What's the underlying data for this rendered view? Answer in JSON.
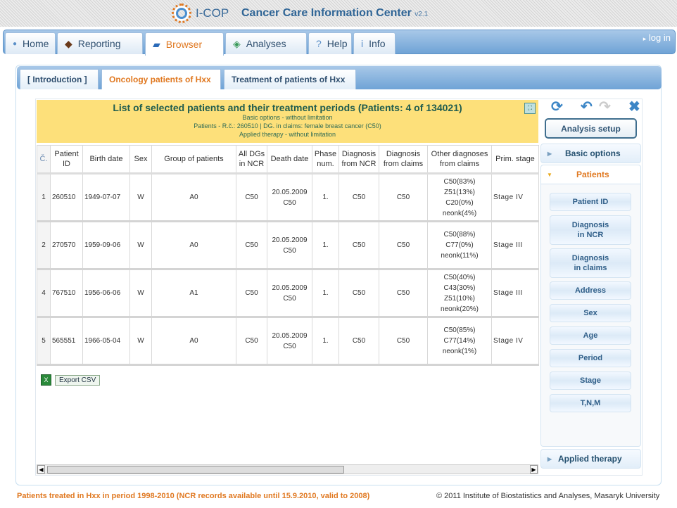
{
  "header": {
    "logo": "I-COP",
    "title": "Cancer Care Information Center",
    "version": "v2.1"
  },
  "nav": {
    "tabs": [
      {
        "label": "Home",
        "icon": "bullet-icon"
      },
      {
        "label": "Reporting",
        "icon": "book-icon"
      },
      {
        "label": "Browser",
        "icon": "monitor-icon",
        "active": true
      },
      {
        "label": "Analyses",
        "icon": "chart-icon"
      },
      {
        "label": "Help",
        "icon": "question-icon"
      },
      {
        "label": "Info",
        "icon": "info-icon"
      }
    ],
    "login": "log in"
  },
  "subtabs": [
    {
      "label": "[ Introduction ]"
    },
    {
      "label": "Oncology patients of Hxx",
      "active": true
    },
    {
      "label": "Treatment of patients of Hxx"
    }
  ],
  "list": {
    "title": "List of selected patients and their treatment periods (Patients: 4 of 134021)",
    "lines": [
      "Basic options - without limitation",
      "Patients - R.č.: 260510 | DG. in claims: female breast cancer (C50)",
      "Applied therapy - without limitation"
    ]
  },
  "table": {
    "columns": [
      "Č.",
      "Patient ID",
      "Birth date",
      "Sex",
      "Group of patients",
      "All DGs in NCR",
      "Death date",
      "Phase num.",
      "Diagnosis from NCR",
      "Diagnosis from claims",
      "Other diagnoses from claims",
      "Prim. stage"
    ],
    "rows": [
      [
        "1",
        "260510",
        "1949-07-07",
        "W",
        "A0",
        "C50",
        [
          "20.05.2009",
          "C50"
        ],
        "1.",
        "C50",
        "C50",
        [
          "C50(83%)",
          "Z51(13%)",
          "C20(0%)",
          "neonk(4%)"
        ],
        "Stage IV"
      ],
      [
        "2",
        "270570",
        "1959-09-06",
        "W",
        "A0",
        "C50",
        [
          "20.05.2009",
          "C50"
        ],
        "1.",
        "C50",
        "C50",
        [
          "C50(88%)",
          "C77(0%)",
          "neonk(11%)"
        ],
        "Stage III"
      ],
      [
        "4",
        "767510",
        "1956-06-06",
        "W",
        "A1",
        "C50",
        [
          "20.05.2009",
          "C50"
        ],
        "1.",
        "C50",
        "C50",
        [
          "C50(40%)",
          "C43(30%)",
          "Z51(10%)",
          "neonk(20%)"
        ],
        "Stage III"
      ],
      [
        "5",
        "565551",
        "1966-05-04",
        "W",
        "A0",
        "C50",
        [
          "20.05.2009",
          "C50"
        ],
        "1.",
        "C50",
        "C50",
        [
          "C50(85%)",
          "C77(14%)",
          "neonk(1%)"
        ],
        "Stage IV"
      ]
    ]
  },
  "export": {
    "label": "Export CSV"
  },
  "sidebar": {
    "setup": "Analysis setup",
    "basic": "Basic options",
    "patients": "Patients",
    "applied": "Applied therapy",
    "patient_buttons": [
      "Patient ID",
      "Diagnosis in NCR",
      "Diagnosis in claims",
      "Address",
      "Sex",
      "Age",
      "Period",
      "Stage",
      "T,N,M"
    ]
  },
  "footer": {
    "left": "Patients treated in Hxx in period 1998-2010 (NCR records available until 15.9.2010, valid to 2008)",
    "right": "© 2011 Institute of Biostatistics and Analyses, Masaryk University"
  },
  "colors": {
    "accent": "#e07820",
    "nav": "#6fa3d6",
    "list_header": "#fde07a"
  }
}
